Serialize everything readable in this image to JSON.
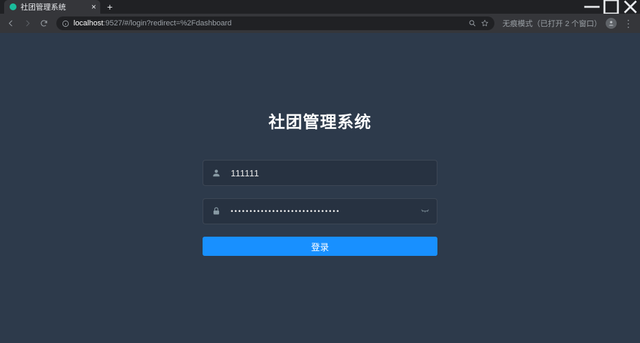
{
  "browser": {
    "tab_title": "社团管理系统",
    "url_host": "localhost",
    "url_port_path": ":9527/#/login?redirect=%2Fdashboard",
    "incognito_label": "无痕模式（已打开 2 个窗口）"
  },
  "login": {
    "title": "社团管理系统",
    "username_value": "111111",
    "password_value": "•••••••••••••••••••••••••••••",
    "submit_label": "登录"
  }
}
